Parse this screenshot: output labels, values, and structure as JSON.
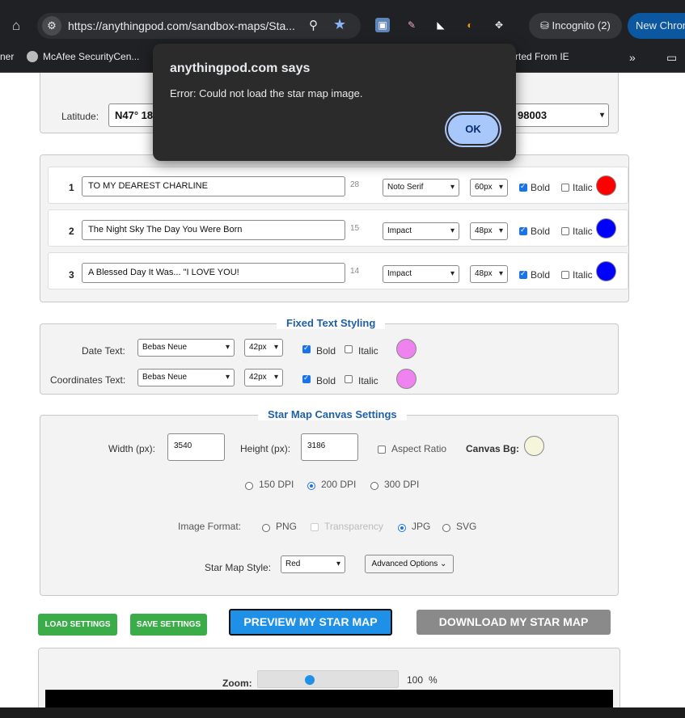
{
  "browser": {
    "url": "https://anythingpod.com/sandbox-maps/Sta...",
    "incognito_label": "Incognito (2)",
    "new_chrome_label": "New Chrom",
    "bookmarks": [
      "ner",
      "McAfee SecurityCen...",
      "rted From IE"
    ]
  },
  "dialog": {
    "title": "anythingpod.com says",
    "message": "Error: Could not load the star map image.",
    "ok_label": "OK"
  },
  "location": {
    "latitude_label": "Latitude:",
    "latitude_value": "N47° 18",
    "right_value": "98003"
  },
  "custom_text": {
    "rows": [
      {
        "num": "1",
        "text": "TO MY DEAREST CHARLINE",
        "count": "28",
        "font": "Noto Serif",
        "size": "60px",
        "bold": "Bold",
        "italic": "Italic",
        "color": "#ff0000"
      },
      {
        "num": "2",
        "text": "The Night Sky The Day You Were Born",
        "count": "15",
        "font": "Impact",
        "size": "48px",
        "bold": "Bold",
        "italic": "Italic",
        "color": "#0000ff"
      },
      {
        "num": "3",
        "text": "A Blessed Day It Was... \"I LOVE YOU!",
        "count": "14",
        "font": "Impact",
        "size": "48px",
        "bold": "Bold",
        "italic": "Italic",
        "color": "#0000ff"
      }
    ]
  },
  "fixed_text": {
    "legend": "Fixed Text Styling",
    "date_label": "Date Text:",
    "date_font": "Bebas Neue",
    "date_size": "42px",
    "coords_label": "Coordinates Text:",
    "coords_font": "Bebas Neue",
    "coords_size": "42px",
    "bold": "Bold",
    "italic": "Italic",
    "color": "#ee82ee"
  },
  "canvas": {
    "legend": "Star Map Canvas Settings",
    "width_label": "Width (px):",
    "width_value": "3540",
    "height_label": "Height (px):",
    "height_value": "3186",
    "aspect_label": "Aspect Ratio",
    "bg_label": "Canvas Bg:",
    "bg_color": "#f5f5dc",
    "dpi_options": [
      "150 DPI",
      "200 DPI",
      "300 DPI"
    ],
    "format_label": "Image Format:",
    "formats": [
      "PNG",
      "Transparency",
      "JPG",
      "SVG"
    ],
    "style_label": "Star Map Style:",
    "style_value": "Red",
    "advanced_label": "Advanced Options"
  },
  "actions": {
    "load": "LOAD SETTINGS",
    "save": "SAVE SETTINGS",
    "preview": "PREVIEW MY STAR MAP",
    "download": "DOWNLOAD MY STAR MAP"
  },
  "zoom": {
    "label": "Zoom:",
    "value": "100",
    "unit": "%",
    "level": 0.36
  }
}
